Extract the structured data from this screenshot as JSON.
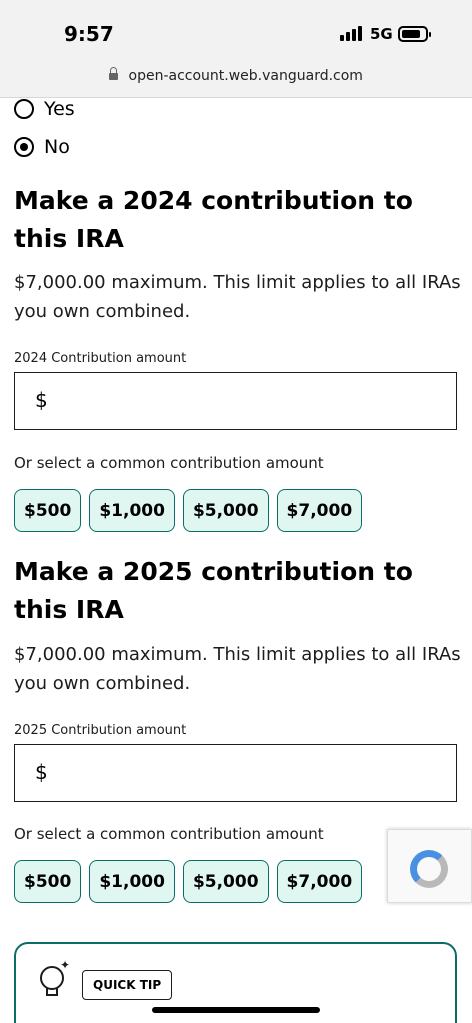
{
  "status_bar": {
    "time": "9:57",
    "network": "5G"
  },
  "browser": {
    "url": "open-account.web.vanguard.com"
  },
  "radio_options": [
    {
      "label": "Yes",
      "checked": false
    },
    {
      "label": "No",
      "checked": true
    }
  ],
  "sections": [
    {
      "title": "Make a 2024 contribution to this IRA",
      "description": "$7,000.00 maximum. This limit applies to all IRAs you own combined.",
      "field_label": "2024 Contribution amount",
      "currency_symbol": "$",
      "value": "",
      "helper": "Or select a common contribution amount",
      "amounts": [
        "$500",
        "$1,000",
        "$5,000",
        "$7,000"
      ]
    },
    {
      "title": "Make a 2025 contribution to this IRA",
      "description": "$7,000.00 maximum. This limit applies to all IRAs you own combined.",
      "field_label": "2025 Contribution amount",
      "currency_symbol": "$",
      "value": "",
      "helper": "Or select a common contribution amount",
      "amounts": [
        "$500",
        "$1,000",
        "$5,000",
        "$7,000"
      ]
    }
  ],
  "tip": {
    "label": "QUICK TIP"
  },
  "icons": {
    "lock": "lock-icon",
    "battery": "battery-icon",
    "signal": "signal-icon",
    "recaptcha": "recaptcha-icon",
    "lightbulb": "lightbulb-icon"
  },
  "colors": {
    "accent": "#0a6e66",
    "pill_background": "#e0f6f1",
    "text": "#1c1c1c"
  }
}
